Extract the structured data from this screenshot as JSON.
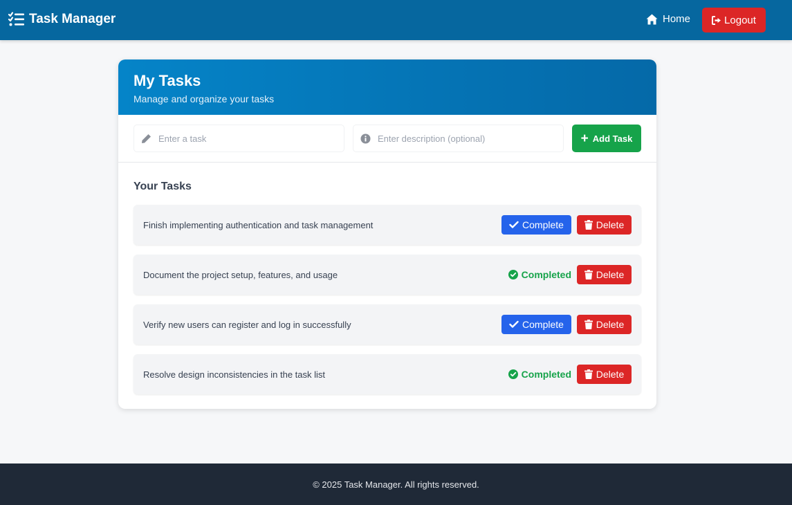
{
  "navbar": {
    "brand": "Task Manager",
    "brand_icon": "task-list-icon",
    "home_label": "Home",
    "home_icon": "home-icon",
    "logout_label": "Logout",
    "logout_icon": "sign-out-icon"
  },
  "card": {
    "title": "My Tasks",
    "subtitle": "Manage and organize your tasks"
  },
  "form": {
    "task_placeholder": "Enter a task",
    "task_icon": "pencil-icon",
    "description_placeholder": "Enter description (optional)",
    "description_icon": "info-icon",
    "add_label": "Add Task",
    "add_icon": "plus-icon"
  },
  "tasks_section": {
    "title": "Your Tasks",
    "tasks": [
      {
        "text": "Finish implementing authentication and task management",
        "completed": false,
        "action_label": "Complete",
        "delete_label": "Delete"
      },
      {
        "text": "Document the project setup, features, and usage",
        "completed": true,
        "status_label": "Completed",
        "delete_label": "Delete"
      },
      {
        "text": "Verify new users can register and log in successfully",
        "completed": false,
        "action_label": "Complete",
        "delete_label": "Delete"
      },
      {
        "text": "Resolve design inconsistencies in the task list",
        "completed": true,
        "status_label": "Completed",
        "delete_label": "Delete"
      }
    ]
  },
  "footer": {
    "text": "© 2025 Task Manager. All rights reserved."
  },
  "colors": {
    "navbar": "#06679f",
    "header_gradient_start": "#0584c8",
    "header_gradient_end": "#0569a8",
    "add_button": "#16a34a",
    "complete_button": "#2563eb",
    "delete_button": "#dc2626",
    "completed_status": "#16a34a",
    "footer": "#1f2937"
  }
}
